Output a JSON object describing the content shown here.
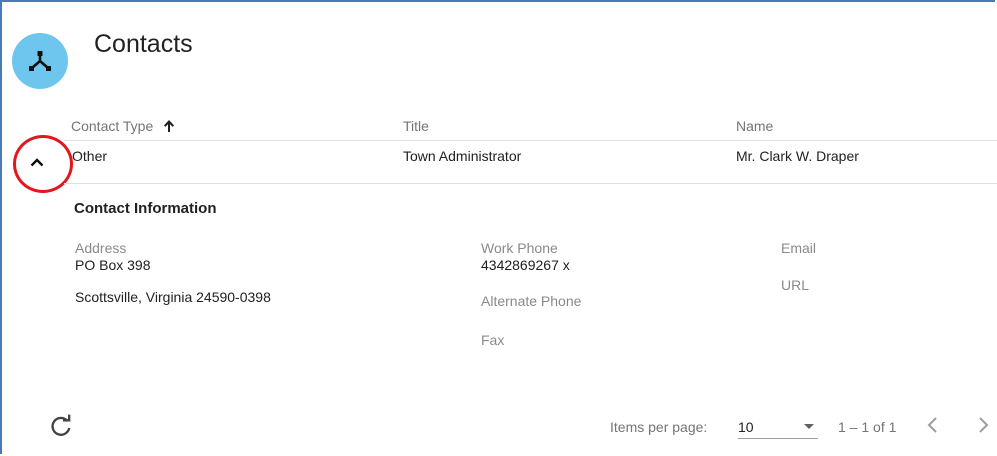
{
  "page": {
    "title": "Contacts",
    "icon": "share-network-icon",
    "accent": "#6ec6ef"
  },
  "table": {
    "headers": {
      "contact_type": "Contact Type",
      "title": "Title",
      "name": "Name"
    },
    "sort": {
      "column": "contact_type",
      "direction": "ascending",
      "icon": "arrow-up-icon"
    },
    "rows": [
      {
        "contact_type": "Other",
        "title": "Town Administrator",
        "name": "Mr. Clark W. Draper",
        "expanded": true
      }
    ]
  },
  "detail": {
    "section_title": "Contact Information",
    "address_label": "Address",
    "address_line1": "PO Box 398",
    "address_line2": "Scottsville, Virginia 24590-0398",
    "work_phone_label": "Work Phone",
    "work_phone": "4342869267 x",
    "alternate_phone_label": "Alternate Phone",
    "fax_label": "Fax",
    "email_label": "Email",
    "url_label": "URL"
  },
  "highlight_color": "#e3161b",
  "paginator": {
    "items_per_page_label": "Items per page:",
    "items_per_page": "10",
    "range": "1 – 1 of 1",
    "refresh_icon": "refresh-icon",
    "prev_icon": "chevron-left-icon",
    "next_icon": "chevron-right-icon"
  }
}
